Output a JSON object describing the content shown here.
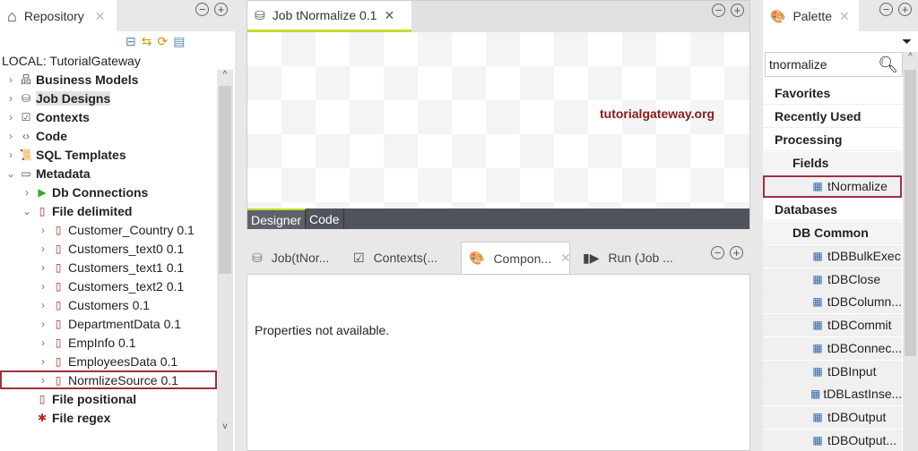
{
  "repository": {
    "tab_label": "Repository",
    "root_label": "LOCAL: TutorialGateway",
    "items": [
      {
        "label": "Business Models",
        "level": 0,
        "bold": true,
        "expanded": false,
        "icon": "org-chart-icon"
      },
      {
        "label": "Job Designs",
        "level": 0,
        "bold": true,
        "expanded": false,
        "icon": "job-icon",
        "highlight": true
      },
      {
        "label": "Contexts",
        "level": 0,
        "bold": true,
        "expanded": false,
        "icon": "contexts-icon"
      },
      {
        "label": "Code",
        "level": 0,
        "bold": true,
        "expanded": false,
        "icon": "code-icon"
      },
      {
        "label": "SQL Templates",
        "level": 0,
        "bold": true,
        "expanded": false,
        "icon": "script-icon"
      },
      {
        "label": "Metadata",
        "level": 0,
        "bold": true,
        "expanded": true,
        "icon": "metadata-icon"
      },
      {
        "label": "Db Connections",
        "level": 1,
        "bold": true,
        "expanded": false,
        "icon": "db-connection-icon"
      },
      {
        "label": "File delimited",
        "level": 1,
        "bold": true,
        "expanded": true,
        "icon": "file-delimited-icon"
      },
      {
        "label": "Customer_Country 0.1",
        "level": 2,
        "icon": "file-delimited-icon"
      },
      {
        "label": "Customers_text0 0.1",
        "level": 2,
        "icon": "file-delimited-icon"
      },
      {
        "label": "Customers_text1 0.1",
        "level": 2,
        "icon": "file-delimited-icon"
      },
      {
        "label": "Customers_text2 0.1",
        "level": 2,
        "icon": "file-delimited-icon"
      },
      {
        "label": "Customers 0.1",
        "level": 2,
        "icon": "file-delimited-icon"
      },
      {
        "label": "DepartmentData 0.1",
        "level": 2,
        "icon": "file-delimited-icon"
      },
      {
        "label": "EmpInfo 0.1",
        "level": 2,
        "icon": "file-delimited-icon"
      },
      {
        "label": "EmployeesData 0.1",
        "level": 2,
        "icon": "file-delimited-icon"
      },
      {
        "label": "NormlizeSource 0.1",
        "level": 2,
        "icon": "file-delimited-icon",
        "selected": true
      },
      {
        "label": "File positional",
        "level": 1,
        "bold": true,
        "noarrow": true,
        "icon": "file-positional-icon"
      },
      {
        "label": "File regex",
        "level": 1,
        "bold": true,
        "noarrow": true,
        "icon": "file-regex-icon"
      }
    ]
  },
  "editor": {
    "tab_label": "Job tNormalize 0.1",
    "watermark": "tutorialgateway.org",
    "bottom_tabs": [
      "Designer",
      "Code"
    ]
  },
  "bottom": {
    "tabs": [
      "Job(tNor...",
      "Contexts(...",
      "Compon...",
      "Run (Job ..."
    ],
    "message": "Properties not available."
  },
  "palette": {
    "tab_label": "Palette",
    "search_value": "tnormalize",
    "items": [
      {
        "label": "Favorites",
        "type": "cat"
      },
      {
        "label": "Recently Used",
        "type": "cat"
      },
      {
        "label": "Processing",
        "type": "cat"
      },
      {
        "label": "Fields",
        "type": "sub"
      },
      {
        "label": "tNormalize",
        "type": "item",
        "selected": true
      },
      {
        "label": "Databases",
        "type": "cat"
      },
      {
        "label": "DB Common",
        "type": "sub"
      },
      {
        "label": "tDBBulkExec",
        "type": "item"
      },
      {
        "label": "tDBClose",
        "type": "item"
      },
      {
        "label": "tDBColumn...",
        "type": "item"
      },
      {
        "label": "tDBCommit",
        "type": "item"
      },
      {
        "label": "tDBConnec...",
        "type": "item"
      },
      {
        "label": "tDBInput",
        "type": "item"
      },
      {
        "label": "tDBLastInse...",
        "type": "item"
      },
      {
        "label": "tDBOutput",
        "type": "item"
      },
      {
        "label": "tDBOutput...",
        "type": "item"
      }
    ]
  },
  "colors": {
    "accent": "#c8d92b",
    "selection": "#a03040",
    "dark_bar": "#50545c",
    "watermark": "#8b1a1a"
  }
}
